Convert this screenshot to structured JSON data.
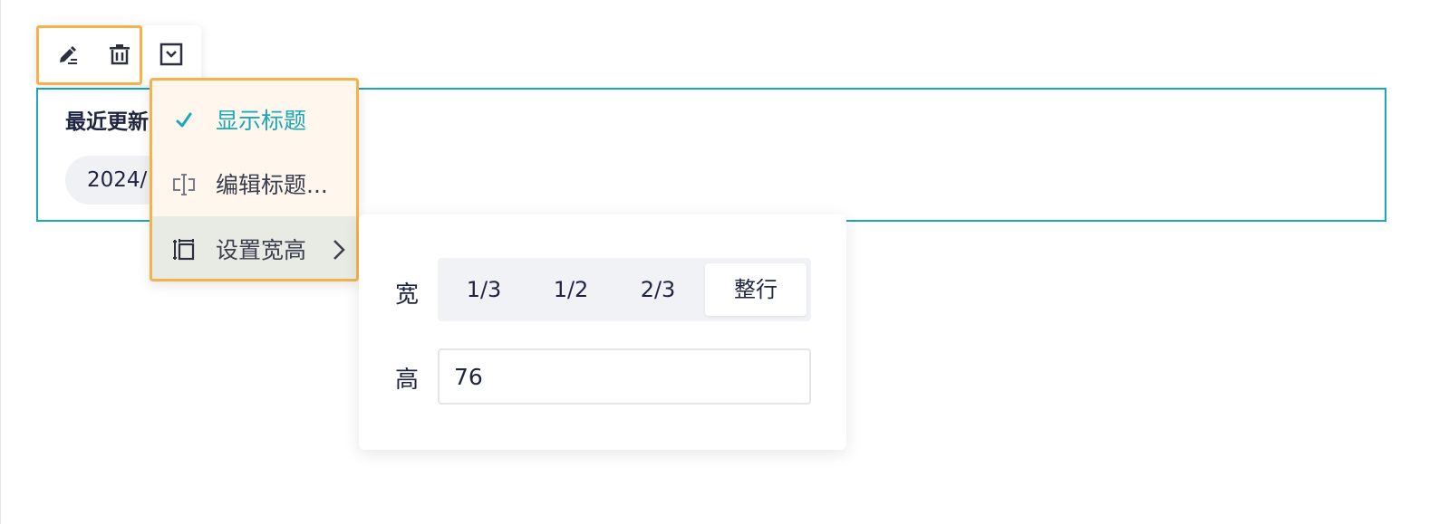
{
  "widget": {
    "title": "最近更新",
    "date": "2024/"
  },
  "toolbar": {
    "buttons": [
      {
        "name": "edit",
        "icon": "edit-icon"
      },
      {
        "name": "delete",
        "icon": "trash-icon"
      },
      {
        "name": "more",
        "icon": "dropdown-box-icon"
      }
    ]
  },
  "menu": {
    "items": [
      {
        "label": "显示标题",
        "icon": "check-icon",
        "checked": true
      },
      {
        "label": "编辑标题...",
        "icon": "text-cursor-icon"
      },
      {
        "label": "设置宽高",
        "icon": "resize-icon",
        "has_submenu": true
      }
    ]
  },
  "submenu": {
    "width_label": "宽",
    "width_options": [
      "1/3",
      "1/2",
      "2/3",
      "整行"
    ],
    "width_selected": "整行",
    "height_label": "高",
    "height_value": "76"
  },
  "colors": {
    "accent": "#1aa9b8",
    "highlight": "#f6b24a",
    "menu_bg": "#fff7ee",
    "text": "#1f2541"
  }
}
